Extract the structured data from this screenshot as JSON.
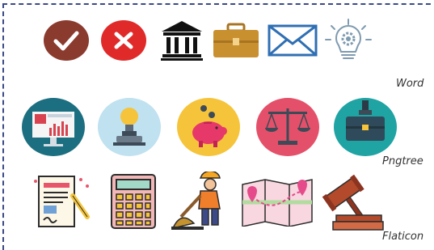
{
  "labels": {
    "word": "Word",
    "pngtree": "Pngtree",
    "flaticon": "Flaticon"
  },
  "rows": {
    "word": [
      "check-circle-icon",
      "cross-circle-icon",
      "bank-icon",
      "briefcase-icon",
      "envelope-icon",
      "lightbulb-gear-icon"
    ],
    "pngtree": [
      "monitor-dashboard-icon",
      "idea-lightbulb-icon",
      "piggy-bank-icon",
      "scales-of-justice-icon",
      "briefcase-hand-icon"
    ],
    "flaticon": [
      "contract-signing-icon",
      "calculator-icon",
      "construction-worker-icon",
      "map-route-icon",
      "judge-gavel-icon"
    ]
  },
  "colors": {
    "frame": "#3b4a86",
    "check": "#8b3a2e",
    "cross": "#e02a2a",
    "briefcase": "#c9902f",
    "envelope": "#2f6fb3",
    "teal": "#1f8a9a",
    "pink_circle": "#e45069",
    "yellow_circle": "#f5c43a",
    "light_blue_circle": "#bfe1f0"
  }
}
